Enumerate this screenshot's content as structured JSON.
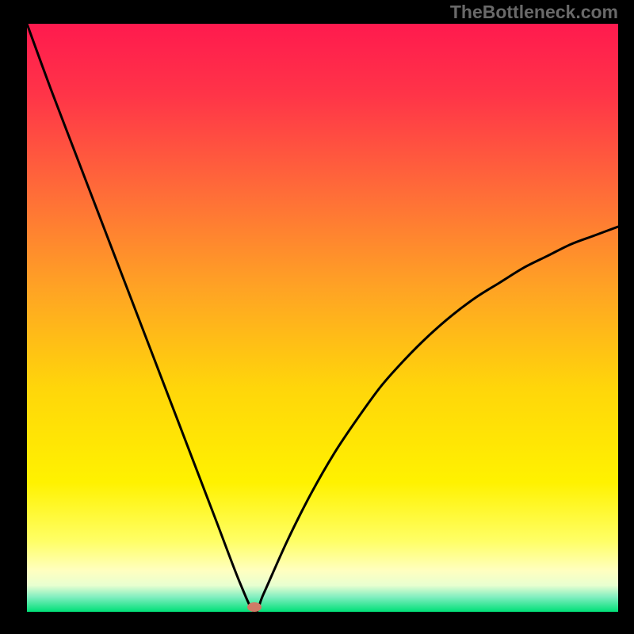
{
  "watermark": {
    "text": "TheBottleneck.com"
  },
  "chart_data": {
    "type": "line",
    "title": "",
    "xlabel": "",
    "ylabel": "",
    "xlim": [
      0,
      100
    ],
    "ylim": [
      0,
      100
    ],
    "grid": false,
    "series": [
      {
        "name": "bottleneck-curve",
        "x": [
          0,
          4,
          8,
          12,
          16,
          20,
          24,
          28,
          32,
          36,
          38.5,
          40,
          44,
          48,
          52,
          56,
          60,
          64,
          68,
          72,
          76,
          80,
          84,
          88,
          92,
          96,
          100
        ],
        "values": [
          100,
          89,
          78.5,
          68,
          57.5,
          47,
          36.5,
          26,
          15.5,
          5,
          0,
          3,
          12,
          20,
          27,
          33,
          38.5,
          43,
          47,
          50.5,
          53.5,
          56,
          58.5,
          60.5,
          62.5,
          64,
          65.5
        ]
      }
    ],
    "marker": {
      "x": 38.5,
      "y": 0.8,
      "color": "#cf7a66"
    },
    "background_gradient": {
      "stops": [
        {
          "pos": 0.0,
          "color": "#ff1a4e"
        },
        {
          "pos": 0.12,
          "color": "#ff3448"
        },
        {
          "pos": 0.28,
          "color": "#ff6a39"
        },
        {
          "pos": 0.45,
          "color": "#ffa324"
        },
        {
          "pos": 0.62,
          "color": "#ffd60a"
        },
        {
          "pos": 0.78,
          "color": "#fff200"
        },
        {
          "pos": 0.88,
          "color": "#ffff66"
        },
        {
          "pos": 0.93,
          "color": "#ffffc0"
        },
        {
          "pos": 0.955,
          "color": "#e8ffd0"
        },
        {
          "pos": 0.975,
          "color": "#80eec0"
        },
        {
          "pos": 1.0,
          "color": "#00e077"
        }
      ]
    }
  }
}
